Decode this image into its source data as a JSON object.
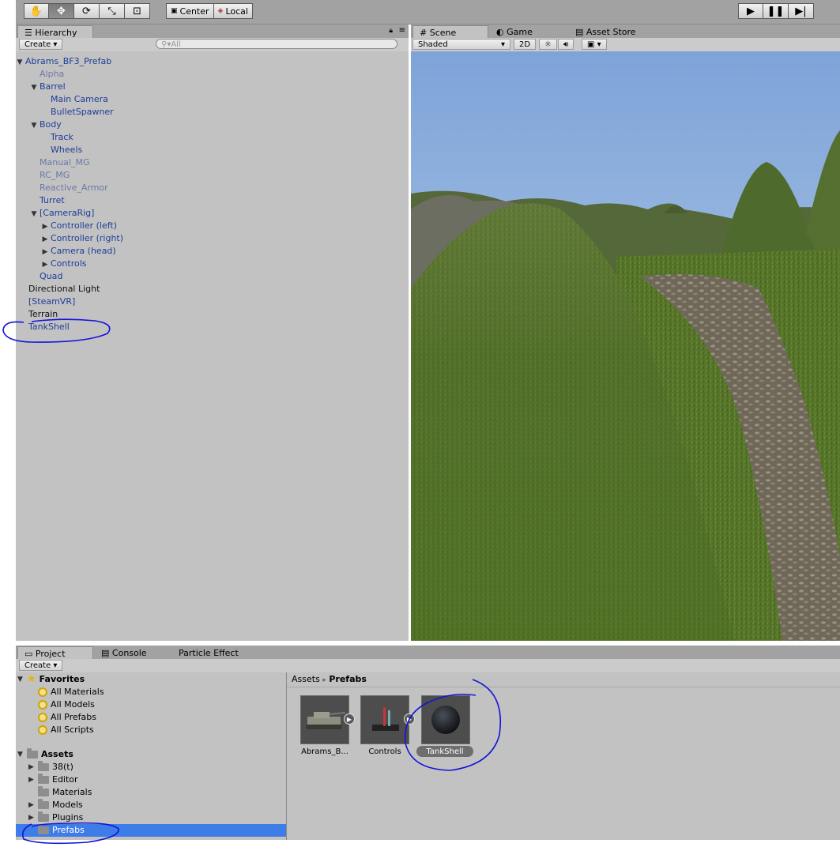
{
  "toolbar": {
    "tools": [
      "hand-icon",
      "move-icon",
      "rotate-icon",
      "scale-icon",
      "rect-icon"
    ],
    "pivot_label": "Center",
    "space_label": "Local"
  },
  "hierarchy": {
    "tab_label": "Hierarchy",
    "create_label": "Create",
    "search_placeholder": "All",
    "items": [
      {
        "label": "Abrams_BF3_Prefab",
        "expanded": "▼"
      },
      {
        "label": "Alpha"
      },
      {
        "label": "Barrel",
        "expanded": "▼"
      },
      {
        "label": "Main Camera"
      },
      {
        "label": "BulletSpawner"
      },
      {
        "label": "Body",
        "expanded": "▼"
      },
      {
        "label": "Track"
      },
      {
        "label": "Wheels"
      },
      {
        "label": "Manual_MG"
      },
      {
        "label": "RC_MG"
      },
      {
        "label": "Reactive_Armor"
      },
      {
        "label": "Turret"
      },
      {
        "label": "[CameraRig]",
        "expanded": "▼"
      },
      {
        "label": "Controller (left)",
        "expanded": "▶"
      },
      {
        "label": "Controller (right)",
        "expanded": "▶"
      },
      {
        "label": "Camera (head)",
        "expanded": "▶"
      },
      {
        "label": "Controls",
        "expanded": "▶"
      },
      {
        "label": "Quad"
      },
      {
        "label": "Directional Light"
      },
      {
        "label": "[SteamVR]"
      },
      {
        "label": "Terrain"
      },
      {
        "label": "TankShell"
      }
    ]
  },
  "scene": {
    "tabs": [
      "Scene",
      "Game",
      "Asset Store"
    ],
    "shading_mode": "Shaded",
    "mode_2d": "2D"
  },
  "project": {
    "tabs": [
      "Project",
      "Console",
      "Particle Effect"
    ],
    "create_label": "Create",
    "favorites_label": "Favorites",
    "favorites": [
      "All Materials",
      "All Models",
      "All Prefabs",
      "All Scripts"
    ],
    "assets_label": "Assets",
    "asset_folders": [
      {
        "label": "38(t)",
        "expanded": "▶"
      },
      {
        "label": "Editor",
        "expanded": "▶"
      },
      {
        "label": "Materials"
      },
      {
        "label": "Models",
        "expanded": "▶"
      },
      {
        "label": "Plugins",
        "expanded": "▶"
      },
      {
        "label": "Prefabs"
      }
    ],
    "breadcrumb_root": "Assets",
    "breadcrumb_sep": "▸",
    "breadcrumb_current": "Prefabs",
    "assets": [
      "Abrams_B...",
      "Controls",
      "TankShell"
    ]
  },
  "colors": {
    "selection": "#3e7ce8",
    "annotation": "#1414d8",
    "panel": "#c2c2c2"
  }
}
